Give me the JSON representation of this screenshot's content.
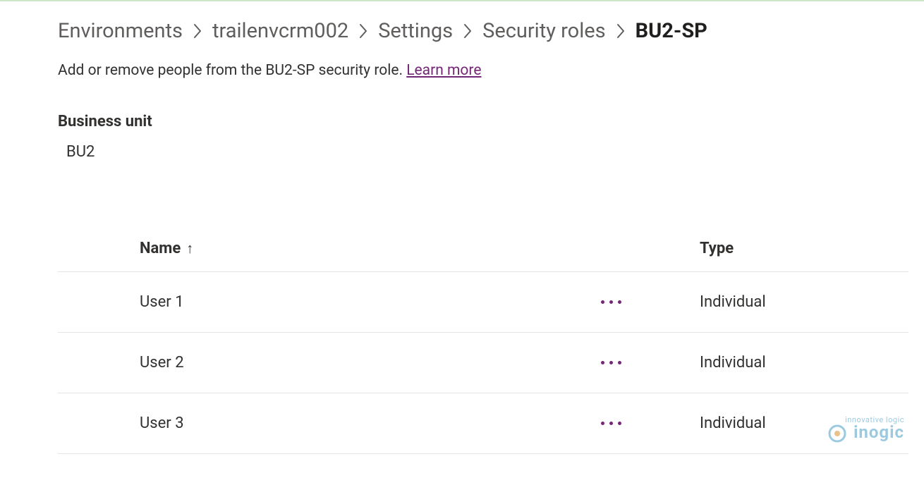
{
  "breadcrumb": {
    "items": [
      {
        "label": "Environments"
      },
      {
        "label": "trailenvcrm002"
      },
      {
        "label": "Settings"
      },
      {
        "label": "Security roles"
      }
    ],
    "current": "BU2-SP"
  },
  "subtext": {
    "text": "Add or remove people from the BU2-SP security role. ",
    "link": "Learn more"
  },
  "business_unit": {
    "label": "Business unit",
    "value": "BU2"
  },
  "table": {
    "columns": {
      "name": "Name",
      "type": "Type",
      "sort_indicator": "↑"
    },
    "rows": [
      {
        "name": "User 1",
        "type": "Individual"
      },
      {
        "name": "User 2",
        "type": "Individual"
      },
      {
        "name": "User 3",
        "type": "Individual"
      }
    ]
  },
  "watermark": {
    "tagline": "innovative logic",
    "brand": "inogic"
  }
}
